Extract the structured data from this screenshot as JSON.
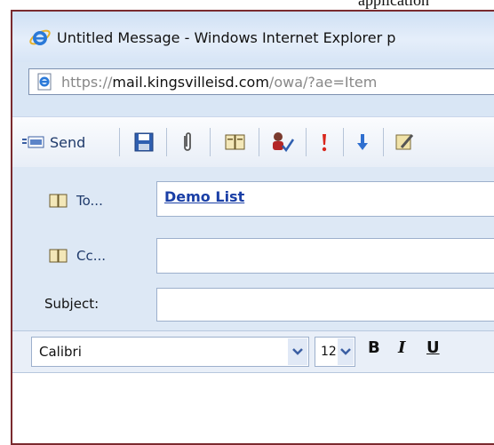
{
  "page_caption_fragment": "application",
  "window": {
    "title": "Untitled Message - Windows Internet Explorer p",
    "icon": "ie-logo-icon"
  },
  "address_bar": {
    "url_prefix": "https://",
    "url_domain": "mail.kingsvilleisd.com",
    "url_path": "/owa/?ae=Item",
    "icon": "page-icon"
  },
  "toolbar": {
    "send_label": "Send",
    "icons": [
      "send-icon",
      "save-icon",
      "attach-icon",
      "address-book-icon",
      "check-names-icon",
      "importance-high-icon",
      "importance-low-icon",
      "options-icon"
    ]
  },
  "compose": {
    "to_label": "To...",
    "to_value": "Demo List",
    "cc_label": "Cc...",
    "cc_value": "",
    "subject_label": "Subject:",
    "subject_value": ""
  },
  "format_bar": {
    "font_name": "Calibri",
    "font_size": "12",
    "bold": "B",
    "italic": "I",
    "underline": "U"
  },
  "colors": {
    "window_border": "#7a2a2e",
    "link": "#1a3fa6",
    "label": "#1f3a6b"
  }
}
